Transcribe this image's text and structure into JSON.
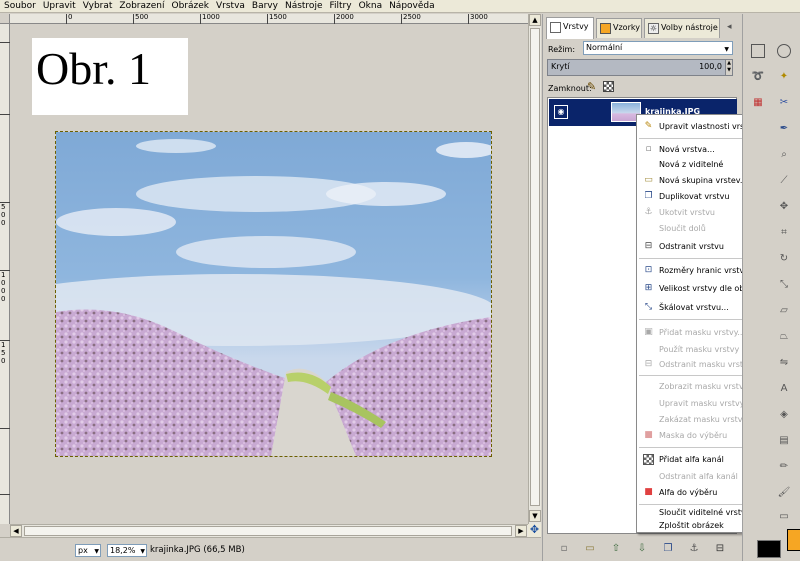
{
  "menubar": {
    "items": [
      "Soubor",
      "Upravit",
      "Vybrat",
      "Zobrazení",
      "Obrázek",
      "Vrstva",
      "Barvy",
      "Nástroje",
      "Filtry",
      "Okna",
      "Nápověda"
    ]
  },
  "ruler": {
    "top_labels": [
      "0",
      "500",
      "1000",
      "1500",
      "2000",
      "2500",
      "3000"
    ],
    "left_labels": [
      "5",
      "0",
      "0",
      "1",
      "0",
      "0",
      "0",
      "1",
      "5",
      "0"
    ]
  },
  "canvas": {
    "annotation_text": "Obr. 1"
  },
  "statusbar": {
    "unit": "px",
    "zoom": "18,2%",
    "file_info": "krajinka.JPG (66,5 MB)"
  },
  "dock": {
    "tabs": [
      "Vrstvy",
      "Vzorky",
      "Volby nástroje"
    ],
    "mode_label": "Režim:",
    "mode_value": "Normální",
    "opacity_label": "Krytí",
    "opacity_value": "100,0",
    "lock_label": "Zamknout:",
    "layer_name": "krajinka.JPG"
  },
  "context_menu": {
    "items": [
      {
        "label": "Upravit vlastnosti vrstvy...",
        "icon": "edit-icon",
        "disabled": false
      },
      {
        "label": "Nová vrstva...",
        "icon": "new-layer-icon",
        "disabled": false
      },
      {
        "label": "Nová z viditelné",
        "icon": "",
        "disabled": false
      },
      {
        "label": "Nová skupina vrstev...",
        "icon": "folder-icon",
        "disabled": false
      },
      {
        "label": "Duplikovat vrstvu",
        "icon": "duplicate-icon",
        "disabled": false
      },
      {
        "label": "Ukotvit vrstvu",
        "icon": "anchor-icon",
        "disabled": true
      },
      {
        "label": "Sloučit dolů",
        "icon": "",
        "disabled": true
      },
      {
        "label": "Odstranit vrstvu",
        "icon": "delete-icon",
        "disabled": false
      },
      {
        "label": "Rozměry hranic vrstvy...",
        "icon": "boundary-icon",
        "disabled": false
      },
      {
        "label": "Velikost vrstvy dle obrázku",
        "icon": "fit-icon",
        "disabled": false
      },
      {
        "label": "Škálovat vrstvu...",
        "icon": "scale-icon",
        "disabled": false
      },
      {
        "label": "Přidat masku vrstvy...",
        "icon": "mask-add-icon",
        "disabled": true
      },
      {
        "label": "Použít masku vrstvy",
        "icon": "",
        "disabled": true
      },
      {
        "label": "Odstranit masku vrstvy",
        "icon": "mask-delete-icon",
        "disabled": true
      },
      {
        "label": "Zobrazit masku vrstvy",
        "icon": "",
        "disabled": true
      },
      {
        "label": "Upravit masku vrstvy",
        "icon": "",
        "disabled": true
      },
      {
        "label": "Zakázat masku vrstvy",
        "icon": "",
        "disabled": true
      },
      {
        "label": "Maska do výběru",
        "icon": "mask-select-icon",
        "disabled": true
      },
      {
        "label": "Přidat alfa kanál",
        "icon": "alpha-add-icon",
        "disabled": false
      },
      {
        "label": "Odstranit alfa kanál",
        "icon": "",
        "disabled": true
      },
      {
        "label": "Alfa do výběru",
        "icon": "alpha-select-icon",
        "disabled": false
      },
      {
        "label": "Sloučit viditelné vrstvy...",
        "icon": "",
        "disabled": false
      },
      {
        "label": "Zploštit obrázek",
        "icon": "",
        "disabled": false
      }
    ]
  },
  "colors": {
    "selection_blue": "#0a246a",
    "foreground": "#f6a623",
    "background": "#000000"
  }
}
